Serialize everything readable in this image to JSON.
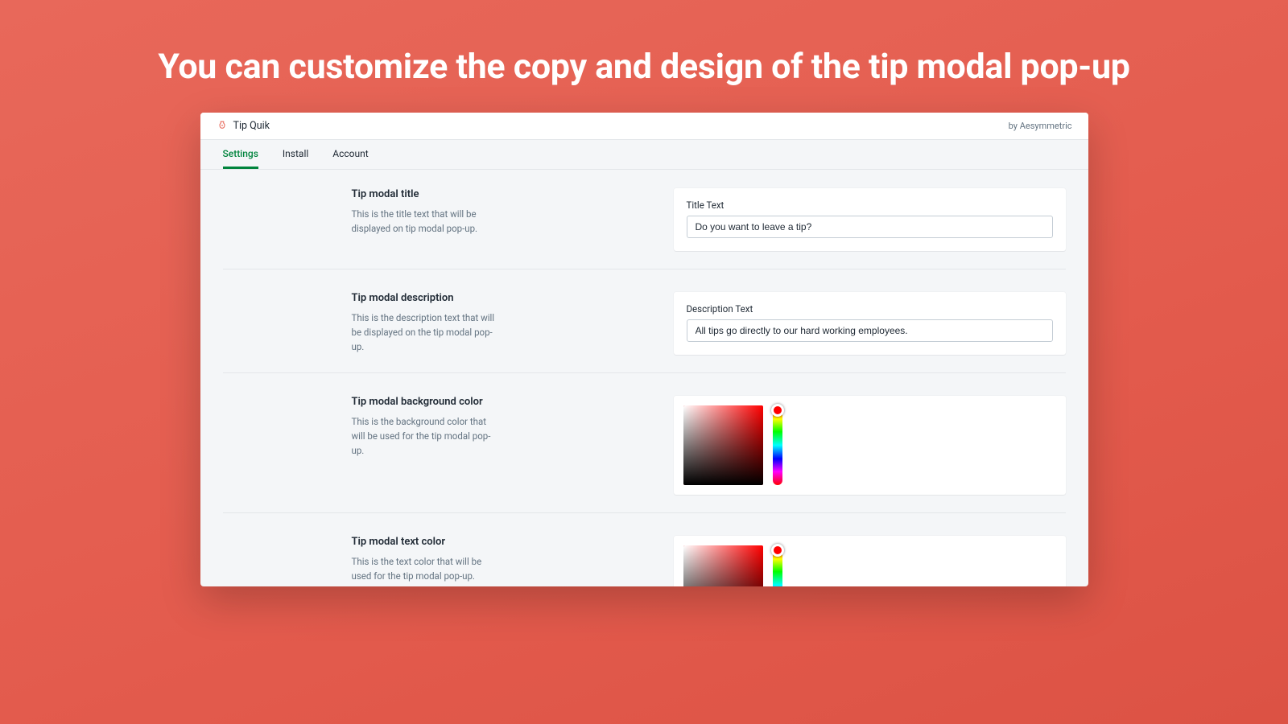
{
  "hero": {
    "title": "You can customize the copy and design of the tip modal pop-up"
  },
  "header": {
    "app_name": "Tip Quik",
    "byline": "by Aesymmetric"
  },
  "tabs": [
    {
      "label": "Settings",
      "active": true
    },
    {
      "label": "Install",
      "active": false
    },
    {
      "label": "Account",
      "active": false
    }
  ],
  "settings": {
    "title_section": {
      "heading": "Tip modal title",
      "description": "This is the title text that will be displayed on tip modal pop-up.",
      "field_label": "Title Text",
      "value": "Do you want to leave a tip?"
    },
    "description_section": {
      "heading": "Tip modal description",
      "description": "This is the description text that will be displayed on the tip modal pop-up.",
      "field_label": "Description Text",
      "value": "All tips go directly to our hard working employees."
    },
    "bg_color_section": {
      "heading": "Tip modal background color",
      "description": "This is the background color that will be used for the tip modal pop-up.",
      "hue_base": "#ff0000"
    },
    "text_color_section": {
      "heading": "Tip modal text color",
      "description": "This is the text color that will be used for the tip modal pop-up.",
      "hue_base": "#ff0000"
    }
  },
  "colors": {
    "accent": "#00843d",
    "background": "#e8685a"
  }
}
